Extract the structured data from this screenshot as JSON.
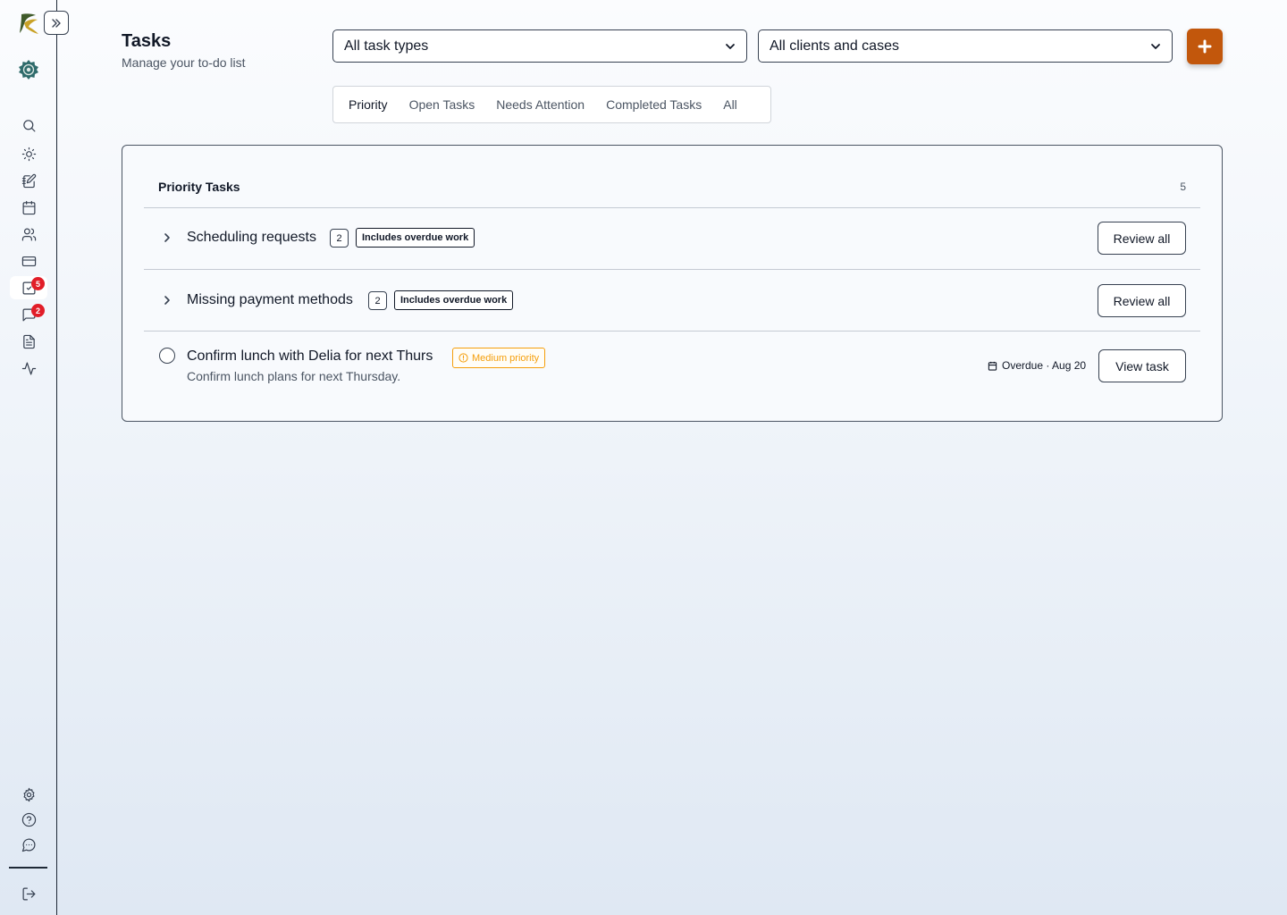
{
  "header": {
    "title": "Tasks",
    "subtitle": "Manage your to-do list",
    "task_type_filter": "All task types",
    "client_filter": "All clients and cases"
  },
  "sidebar": {
    "tasks_badge": "5",
    "messages_badge": "2"
  },
  "tabs": [
    "Priority",
    "Open Tasks",
    "Needs Attention",
    "Completed Tasks",
    "All"
  ],
  "active_tab": "Priority",
  "priority_card": {
    "title": "Priority Tasks",
    "count": "5",
    "groups": [
      {
        "title": "Scheduling requests",
        "count": "2",
        "tag": "Includes overdue work",
        "action": "Review all"
      },
      {
        "title": "Missing payment methods",
        "count": "2",
        "tag": "Includes overdue work",
        "action": "Review all"
      }
    ],
    "task": {
      "title": "Confirm lunch with Delia for next Thurs",
      "priority": "Medium priority",
      "description": "Confirm lunch plans for next Thursday.",
      "due": "Overdue · Aug 20",
      "action": "View task"
    }
  },
  "colors": {
    "accent": "#c2570c",
    "badge": "#e11d28",
    "priority_medium": "#f59e0b"
  }
}
